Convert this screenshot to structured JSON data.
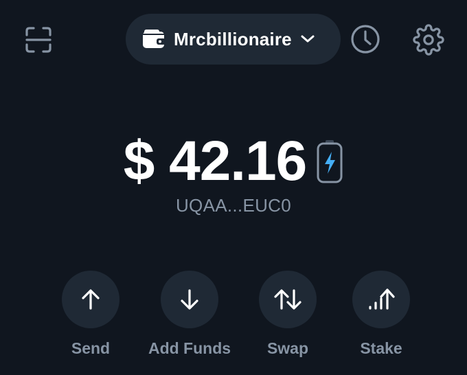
{
  "header": {
    "scan_icon": "scan-qr-icon",
    "wallet_icon": "wallet-icon",
    "wallet_name": "Mrcbillionaire",
    "dropdown_icon": "chevron-down-icon",
    "history_icon": "clock-icon",
    "settings_icon": "gear-icon"
  },
  "balance": {
    "amount": "$ 42.16",
    "battery_icon": "battery-charging-icon",
    "address": "UQAA...EUC0"
  },
  "actions": [
    {
      "label": "Send",
      "icon": "arrow-up-icon"
    },
    {
      "label": "Add Funds",
      "icon": "arrow-down-icon"
    },
    {
      "label": "Swap",
      "icon": "swap-arrows-icon"
    },
    {
      "label": "Stake",
      "icon": "stake-icon"
    }
  ],
  "colors": {
    "background": "#10161f",
    "surface": "#1f2935",
    "text_primary": "#ffffff",
    "text_secondary": "#8794a4",
    "accent": "#45aef5"
  }
}
